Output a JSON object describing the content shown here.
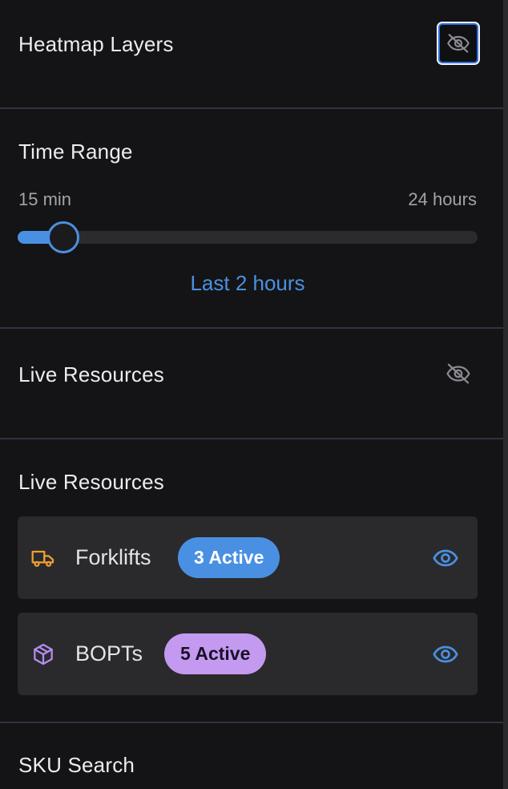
{
  "heatmap": {
    "title": "Heatmap Layers",
    "toggle_icon": "eye-off-icon"
  },
  "time_range": {
    "title": "Time Range",
    "min_label": "15 min",
    "max_label": "24 hours",
    "value_label": "Last 2 hours",
    "slider_fraction": 0.1
  },
  "live_resources_toggle": {
    "title": "Live Resources",
    "toggle_icon": "eye-off-icon"
  },
  "live_resources": {
    "title": "Live Resources",
    "items": [
      {
        "label": "Forklifts",
        "badge": "3 Active",
        "icon": "truck-icon",
        "icon_color": "#f0a030",
        "badge_color": "#4a90e2",
        "visibility_icon": "eye-icon"
      },
      {
        "label": "BOPTs",
        "badge": "5 Active",
        "icon": "package-icon",
        "icon_color": "#b58cf0",
        "badge_color": "#c49af0",
        "visibility_icon": "eye-icon"
      }
    ]
  },
  "sku_search": {
    "title": "SKU Search"
  },
  "colors": {
    "accent": "#4a90e2",
    "background": "#141416",
    "card": "#2a2a2c"
  }
}
